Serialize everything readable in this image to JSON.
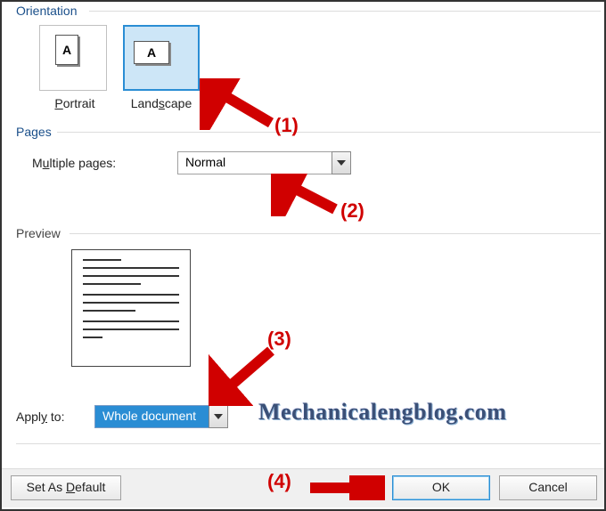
{
  "orientation": {
    "group_label": "Orientation",
    "portrait_label": "Portrait",
    "portrait_mn": "P",
    "landscape_label": "Landscape",
    "landscape_mn": "s",
    "icon_letter": "A"
  },
  "pages": {
    "group_label": "Pages",
    "multi_label_pre": "M",
    "multi_label_mn": "u",
    "multi_label_post": "ltiple pages:",
    "multi_value": "Normal"
  },
  "preview": {
    "group_label": "Preview"
  },
  "applyto": {
    "label_pre": "Appl",
    "label_mn": "y",
    "label_post": " to:",
    "value": "Whole document"
  },
  "buttons": {
    "set_default_pre": "Set As ",
    "set_default_mn": "D",
    "set_default_post": "efault",
    "ok": "OK",
    "cancel": "Cancel"
  },
  "annotations": {
    "a1": "(1)",
    "a2": "(2)",
    "a3": "(3)",
    "a4": "(4)",
    "watermark": "Mechanicalengblog.com"
  }
}
